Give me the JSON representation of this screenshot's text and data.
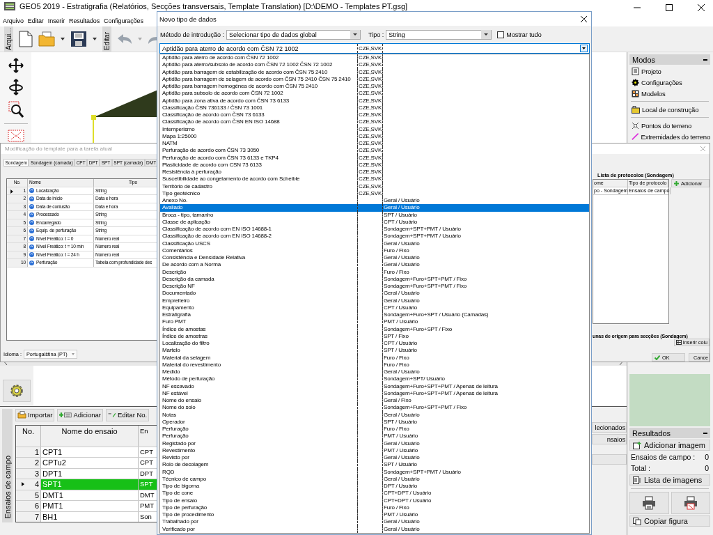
{
  "app_window": {
    "title": "GEO5 2019 - Estratigrafia (Relatórios, Secções transversais, Template Translation) [D:\\DEMO - Templates PT.gsg]",
    "menu": [
      "Arquivo",
      "Editar",
      "Inserir",
      "Resultados",
      "Configurações"
    ],
    "toolbar_labels": [
      "Arqui...",
      "Editar"
    ]
  },
  "modes_panel": {
    "title": "Modos",
    "items": [
      {
        "label": "Projeto",
        "separator_before": false
      },
      {
        "label": "Configurações",
        "separator_before": false
      },
      {
        "label": "Modelos",
        "separator_before": false
      },
      {
        "label": "Local de construção",
        "separator_before": true
      },
      {
        "label": "Pontos do terreno",
        "separator_before": true
      },
      {
        "label": "Extremidades do terreno",
        "separator_before": false
      }
    ]
  },
  "template_dialog": {
    "title": "Modificação do template para a tarefa atual",
    "tabs": [
      {
        "label": "Sondagem",
        "selected": true
      },
      {
        "label": "Sondagem (camada)",
        "selected": false
      },
      {
        "label": "CPT",
        "selected": false
      },
      {
        "label": "DPT",
        "selected": false
      },
      {
        "label": "SPT",
        "selected": false
      },
      {
        "label": "SPT (camada)",
        "selected": false
      },
      {
        "label": "DMT",
        "selected": false
      }
    ],
    "table": {
      "columns": [
        "No.",
        "Nome",
        "Tipo"
      ],
      "rows": [
        {
          "no": "1",
          "name": "Localização",
          "type": "String",
          "current": true
        },
        {
          "no": "2",
          "name": "Data de início",
          "type": "Data e hora",
          "current": false
        },
        {
          "no": "3",
          "name": "Data de conlusão",
          "type": "Data e hora",
          "current": false
        },
        {
          "no": "4",
          "name": "Processado",
          "type": "String",
          "current": false
        },
        {
          "no": "5",
          "name": "Encarregado",
          "type": "String",
          "current": false
        },
        {
          "no": "6",
          "name": "Equip. de perfuração",
          "type": "String",
          "current": false
        },
        {
          "no": "7",
          "name": "Nível Freático: t = 0",
          "type": "Número real",
          "current": false
        },
        {
          "no": "8",
          "name": "Nível Freático: t = 10 min",
          "type": "Número real",
          "current": false
        },
        {
          "no": "9",
          "name": "Nível Freático: t = 24 h",
          "type": "Número real",
          "current": false
        },
        {
          "no": "10",
          "name": "Perfuração",
          "type": "Tabela com profundidade des",
          "current": false
        }
      ]
    },
    "language_label": "Idioma :",
    "language": "Portugalština (PT)",
    "protocols": {
      "title": "Lista de protocolos (Sondagem)",
      "columns": [
        "ome",
        "Tipo de protocolo"
      ],
      "rows": [
        [
          "po - Sondagem",
          "Ensaios de campo"
        ]
      ],
      "add_button": "Adicionar"
    },
    "columns_label": "unas de origem para secções (Sondagem)",
    "insert_button": "Inserir colu",
    "ok_button": "OK",
    "cancel_button": "Cance"
  },
  "field_tests": {
    "side_label": "Ensaios de campo",
    "buttons": [
      "Importar",
      "Adicionar",
      "Editar No."
    ],
    "columns": [
      "No.",
      "Nome do ensaio",
      "En"
    ],
    "rows": [
      {
        "no": "1",
        "name": "CPT1",
        "column_3": "CPT",
        "selected": false
      },
      {
        "no": "2",
        "name": "CPTu2",
        "column_3": "CPT",
        "selected": false
      },
      {
        "no": "3",
        "name": "DPT1",
        "column_3": "DPT",
        "selected": false
      },
      {
        "no": "4",
        "name": "SPT1",
        "column_3": "SPT",
        "selected": true
      },
      {
        "no": "5",
        "name": "DMT1",
        "column_3": "DMT",
        "selected": false
      },
      {
        "no": "6",
        "name": "PMT1",
        "column_3": "PMT",
        "selected": false
      },
      {
        "no": "7",
        "name": "BH1",
        "column_3": "Son",
        "selected": false
      }
    ],
    "side_buttons": [
      "lecionados",
      "nsaios"
    ]
  },
  "results_panel": {
    "title": "Resultados",
    "add_image": "Adicionar imagem",
    "stats": [
      {
        "label": "Ensaios de campo :",
        "value": "0"
      },
      {
        "label": "Total :",
        "value": "0"
      }
    ],
    "image_list": "Lista de imagens",
    "copy_figure": "Copiar figura"
  },
  "data_type_dialog": {
    "title": "Novo tipo de dados",
    "method_label": "Método de introdução :",
    "method": "Selecionar tipo de dados global",
    "type_label": "Tipo :",
    "type": "String",
    "show_all": {
      "label": "Mostrar tudo",
      "checked": false
    },
    "combo": {
      "name": "Aptidão para aterro de acordo com ČSN 72 1002",
      "country": "CZE,SVK"
    },
    "options": [
      {
        "name": "Aptidão para aterro de acordo com ČSN 72 1002",
        "country": "CZE,SVK",
        "selected": false
      },
      {
        "name": "Aptidão para aterro/subsolo de acordo com ČSN 72 1002 ČSN 72 1002",
        "country": "CZE,SVK",
        "selected": false
      },
      {
        "name": "Aptidão para barragem de estabilização de acordo com ČSN 75 2410",
        "country": "CZE,SVK",
        "selected": false
      },
      {
        "name": "Aptidão para barragem de selagem de acordo com ČSN 75 2410 ČSN 75 2410",
        "country": "CZE,SVK",
        "selected": false
      },
      {
        "name": "Aptidão para barragem homogénea de acordo com ČSN 75 2410",
        "country": "CZE,SVK",
        "selected": false
      },
      {
        "name": "Aptidão para subsolo de acordo com ČSN 72 1002",
        "country": "CZE,SVK",
        "selected": false
      },
      {
        "name": "Aptidão para zona ativa de acordo com ČSN 73 6133",
        "country": "CZE,SVK",
        "selected": false
      },
      {
        "name": "Classificação ČSN 736133 / ČSN 73 1001",
        "country": "CZE,SVK",
        "selected": false
      },
      {
        "name": "Classificação de acordo com ČSN 73 6133",
        "country": "CZE,SVK",
        "selected": false
      },
      {
        "name": "Classificação de acordo com ČSN EN ISO 14688",
        "country": "CZE,SVK",
        "selected": false
      },
      {
        "name": "Intemperismo",
        "country": "CZE,SVK",
        "selected": false
      },
      {
        "name": "Mapa 1:25000",
        "country": "CZE,SVK",
        "selected": false
      },
      {
        "name": "NATM",
        "country": "CZE,SVK",
        "selected": false
      },
      {
        "name": "Perfuração de acordo com ČSN 73 3050",
        "country": "CZE,SVK",
        "selected": false
      },
      {
        "name": "Perfuração de acordo com ČSN 73 6133 e TKP4",
        "country": "CZE,SVK",
        "selected": false
      },
      {
        "name": "Plasticidade de acordo com CSN 73 6133",
        "country": "CZE,SVK",
        "selected": false
      },
      {
        "name": "Resistência à perfuração",
        "country": "CZE,SVK",
        "selected": false
      },
      {
        "name": "Suscetibilidade ao congelamento de acordo com Scheible",
        "country": "CZE,SVK",
        "selected": false
      },
      {
        "name": "Território de cadastro",
        "country": "CZE,SVK",
        "selected": false
      },
      {
        "name": "Tipo geotécnico",
        "country": "CZE,SVK",
        "selected": false
      },
      {
        "name": "Anexo No.",
        "group": "Geral / Usuário",
        "selected": false
      },
      {
        "name": "Avaliado",
        "group": "Geral / Usuário",
        "selected": true
      },
      {
        "name": "Broca - tipo, tamanho",
        "group": "SPT / Usuário",
        "selected": false
      },
      {
        "name": "Classe de aplicação",
        "group": "CPT / Usuário",
        "selected": false
      },
      {
        "name": "Classificação de acordo com EN ISO 14688-1",
        "group": "Sondagem+SPT+PMT / Usuário",
        "selected": false
      },
      {
        "name": "Classificação de acordo com EN ISO 14688-2",
        "group": "Sondagem+SPT+PMT / Usuário",
        "selected": false
      },
      {
        "name": "Classificação USCS",
        "group": "Geral / Usuário",
        "selected": false
      },
      {
        "name": "Comentários",
        "group": "Furo / Fixo",
        "selected": false
      },
      {
        "name": "Consistência e Densidade Relativa",
        "group": "Geral / Usuário",
        "selected": false
      },
      {
        "name": "De acordo com a Norma",
        "group": "Geral / Usuário",
        "selected": false
      },
      {
        "name": "Descrição",
        "group": "Furo / Fixo",
        "selected": false
      },
      {
        "name": "Descrição da camada",
        "group": "Sondagem+Furo+SPT+PMT / Fixo",
        "selected": false
      },
      {
        "name": "Descrição NF",
        "group": "Sondagem+Furo+SPT+PMT / Fixo",
        "selected": false
      },
      {
        "name": "Documentado",
        "group": "Geral / Usuário",
        "selected": false
      },
      {
        "name": "Empreiteiro",
        "group": "Geral / Usuário",
        "selected": false
      },
      {
        "name": "Equipamento",
        "group": "CPT / Usuário",
        "selected": false
      },
      {
        "name": "Estratigrafia",
        "group": "Sondagem+Furo+SPT / Usuário (Camadas)",
        "selected": false
      },
      {
        "name": "Furo PMT",
        "group": "PMT / Usuário",
        "selected": false
      },
      {
        "name": "Índice de amostas",
        "group": "Sondagem+Furo+SPT / Fixo",
        "selected": false
      },
      {
        "name": "Índice de amostras",
        "group": "SPT / Fixo",
        "selected": false
      },
      {
        "name": "Localização do filtro",
        "group": "CPT / Usuário",
        "selected": false
      },
      {
        "name": "Martelo",
        "group": "SPT / Usuário",
        "selected": false
      },
      {
        "name": "Material da selagem",
        "group": "Furo / Fixo",
        "selected": false
      },
      {
        "name": "Material do revestimento",
        "group": "Furo / Fixo",
        "selected": false
      },
      {
        "name": "Medido",
        "group": "Geral / Usuário",
        "selected": false
      },
      {
        "name": "Método de perfuração",
        "group": "Sondagem+SPT/ Usuário",
        "selected": false
      },
      {
        "name": "NF escavado",
        "group": "Sondagem+Furo+SPT+PMT / Apenas de leitura",
        "selected": false
      },
      {
        "name": "NF estável",
        "group": "Sondagem+Furo+SPT+PMT / Apenas de leitura",
        "selected": false
      },
      {
        "name": "Nome do ensaio",
        "group": "Geral / Fixo",
        "selected": false
      },
      {
        "name": "Nome do solo",
        "group": "Sondagem+Furo+SPT+PMT / Fixo",
        "selected": false
      },
      {
        "name": "Notas",
        "group": "Geral / Usuário",
        "selected": false
      },
      {
        "name": "Operador",
        "group": "SPT / Usuário",
        "selected": false
      },
      {
        "name": "Perfuração",
        "group": "Furo / Fixo",
        "selected": false
      },
      {
        "name": "Perfuração",
        "group": "PMT / Usuário",
        "selected": false
      },
      {
        "name": "Registado por",
        "group": "Geral / Usuário",
        "selected": false
      },
      {
        "name": "Revestimento",
        "group": "PMT / Usuário",
        "selected": false
      },
      {
        "name": "Revisto por",
        "group": "Geral / Usuário",
        "selected": false
      },
      {
        "name": "Rolo de decolagem",
        "group": "SPT / Usuário",
        "selected": false
      },
      {
        "name": "RQD",
        "group": "Sondagem+SPT+PMT / Usuário",
        "selected": false
      },
      {
        "name": "Técnico de campo",
        "group": "Geral / Usuário",
        "selected": false
      },
      {
        "name": "Tipo de bigorna",
        "group": "DPT / Usuário",
        "selected": false
      },
      {
        "name": "Tipo de cone",
        "group": "CPT+DPT / Usuário",
        "selected": false
      },
      {
        "name": "Tipo de ensaio",
        "group": "CPT+DPT / Usuário",
        "selected": false
      },
      {
        "name": "Tipo de perfuração",
        "group": "Furo / Fixo",
        "selected": false
      },
      {
        "name": "Tipo de procedimento",
        "group": "PMT / Usuário",
        "selected": false
      },
      {
        "name": "Trabalhado por",
        "group": "Geral / Usuário",
        "selected": false
      },
      {
        "name": "Verificado por",
        "group": "Geral / Usuário",
        "selected": false
      }
    ]
  }
}
